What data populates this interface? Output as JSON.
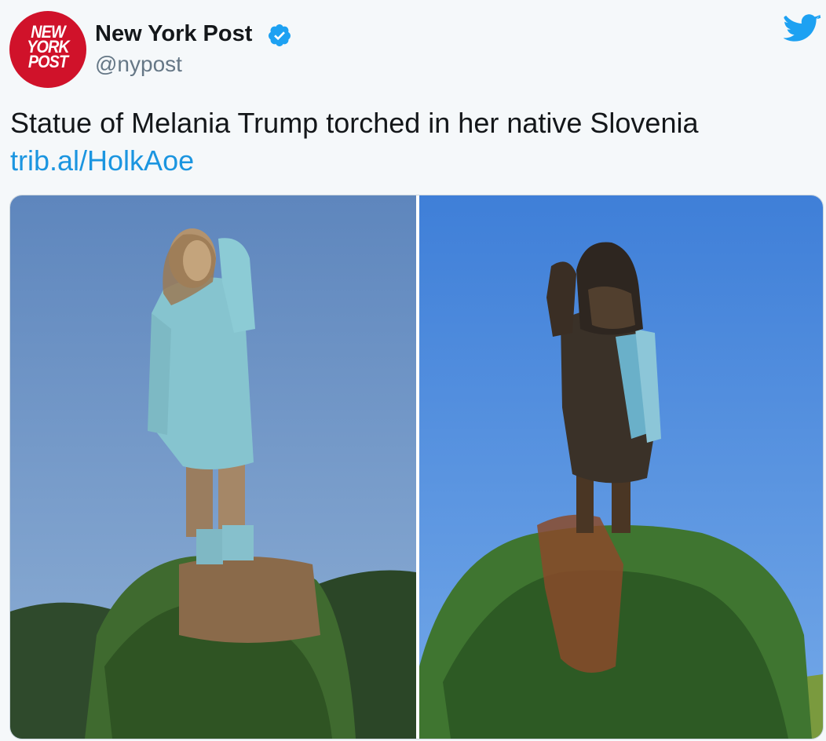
{
  "account": {
    "avatar_lines": [
      "NEW",
      "YORK",
      "POST"
    ],
    "display_name": "New York Post",
    "handle": "@nypost",
    "verified": true
  },
  "tweet": {
    "text": "Statue of Melania Trump torched in her native Slovenia",
    "link": "trib.al/HolkAoe"
  },
  "media": {
    "photos": [
      {
        "alt": "statue-before",
        "description_icon": "statue-photo-icon"
      },
      {
        "alt": "statue-after",
        "description_icon": "statue-photo-icon"
      }
    ]
  },
  "colors": {
    "brand_red": "#d0122a",
    "twitter_blue": "#1da1f2",
    "link_blue": "#1b95e0",
    "text_dark": "#14171a",
    "text_grey": "#657786"
  },
  "icons": {
    "verified": "verified-badge-icon",
    "platform": "twitter-bird-icon"
  }
}
